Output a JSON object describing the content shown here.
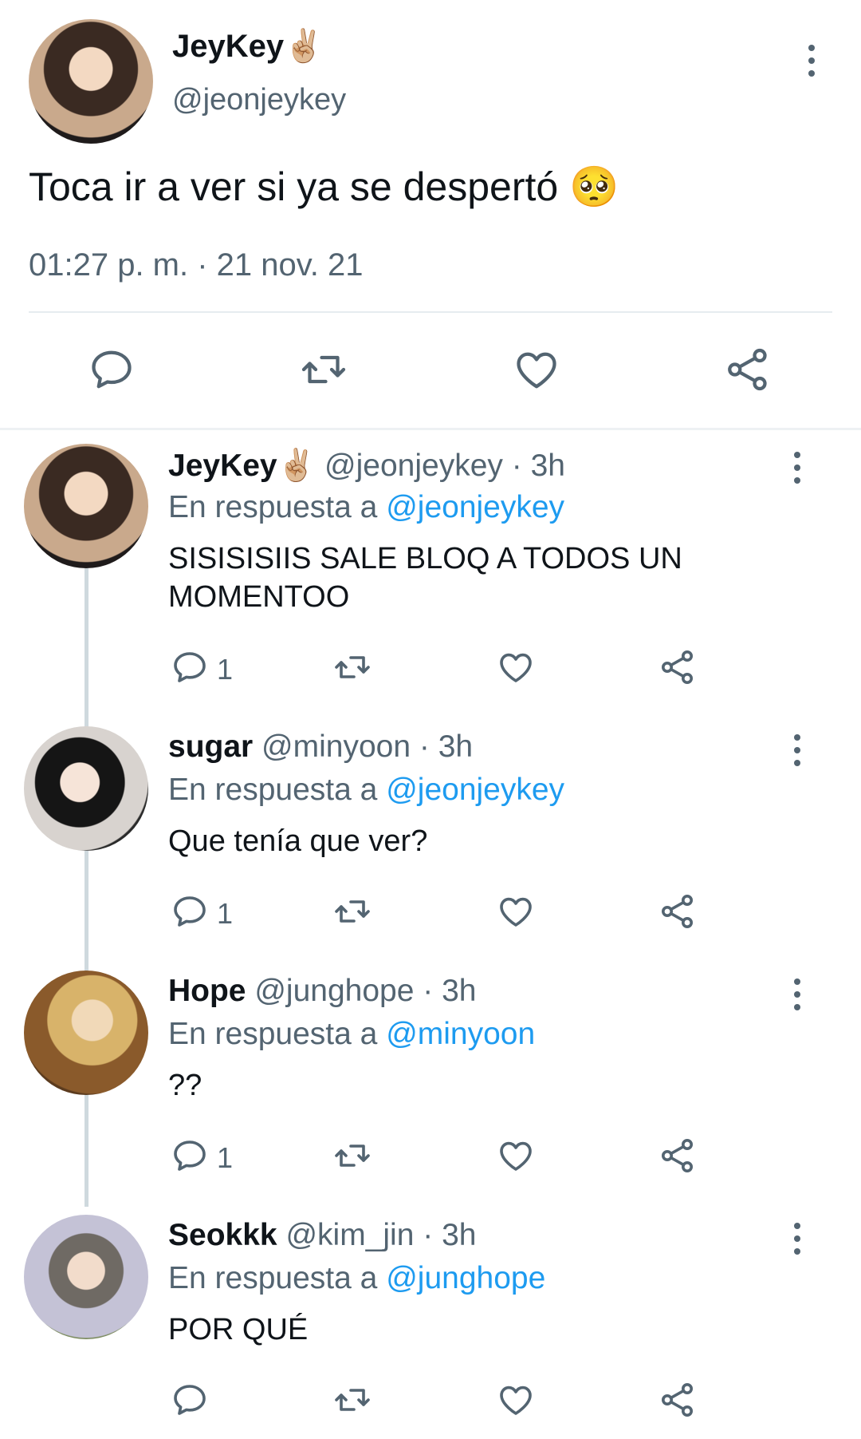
{
  "main_tweet": {
    "name": "JeyKey",
    "name_emoji": "✌🏼",
    "handle": "@jeonjeykey",
    "text": "Toca ir a ver si ya se despertó",
    "text_emoji": "🥺",
    "timestamp": "01:27 p. m. · 21 nov. 21"
  },
  "replies": [
    {
      "name": "JeyKey",
      "name_emoji": "✌🏼",
      "handle": "@jeonjeykey",
      "time": "· 3h",
      "in_reply_label": "En respuesta a",
      "in_reply_to": "@jeonjeykey",
      "text": "SISISISIIS SALE BLOQ A TODOS UN MOMENTOO",
      "reply_count": "1"
    },
    {
      "name": "sugar",
      "handle": "@minyoon",
      "time": "· 3h",
      "in_reply_label": "En respuesta a",
      "in_reply_to": "@jeonjeykey",
      "text": "Que tenía que ver?",
      "reply_count": "1"
    },
    {
      "name": "Hope",
      "handle": "@junghope",
      "time": "· 3h",
      "in_reply_label": "En respuesta a",
      "in_reply_to": "@minyoon",
      "text": "??",
      "reply_count": "1"
    },
    {
      "name": "Seokkk",
      "handle": "@kim_jin",
      "time": "· 3h",
      "in_reply_label": "En respuesta a",
      "in_reply_to": "@junghope",
      "text": "POR QUÉ",
      "reply_count": ""
    }
  ],
  "colors": {
    "text": "#0f1419",
    "muted": "#536471",
    "link": "#1d9bf0",
    "thread_line": "#cfd9de"
  },
  "icons": [
    "reply-icon",
    "retweet-icon",
    "like-icon",
    "share-icon",
    "more-icon"
  ]
}
